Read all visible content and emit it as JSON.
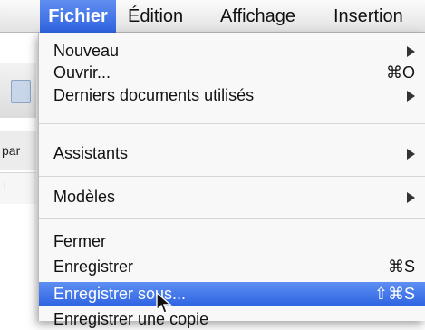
{
  "background": {
    "para_text": "par"
  },
  "menubar": {
    "items": [
      {
        "label": "Fichier"
      },
      {
        "label": "Édition"
      },
      {
        "label": "Affichage"
      },
      {
        "label": "Insertion"
      }
    ]
  },
  "menu": {
    "items": [
      {
        "label": "Nouveau",
        "shortcut": "",
        "submenu": true
      },
      {
        "label": "Ouvrir...",
        "shortcut": "⌘O",
        "submenu": false
      },
      {
        "label": "Derniers documents utilisés",
        "shortcut": "",
        "submenu": true
      },
      {
        "label": "Assistants",
        "shortcut": "",
        "submenu": true
      },
      {
        "label": "Modèles",
        "shortcut": "",
        "submenu": true
      },
      {
        "label": "Fermer",
        "shortcut": "",
        "submenu": false
      },
      {
        "label": "Enregistrer",
        "shortcut": "⌘S",
        "submenu": false
      },
      {
        "label": "Enregistrer sous...",
        "shortcut": "⇧⌘S",
        "submenu": false,
        "highlighted": true
      },
      {
        "label": "Enregistrer une copie",
        "shortcut": "",
        "submenu": false
      }
    ]
  },
  "colors": {
    "highlight": "#2f63e0",
    "menu_bg": "#f8f8f8"
  }
}
